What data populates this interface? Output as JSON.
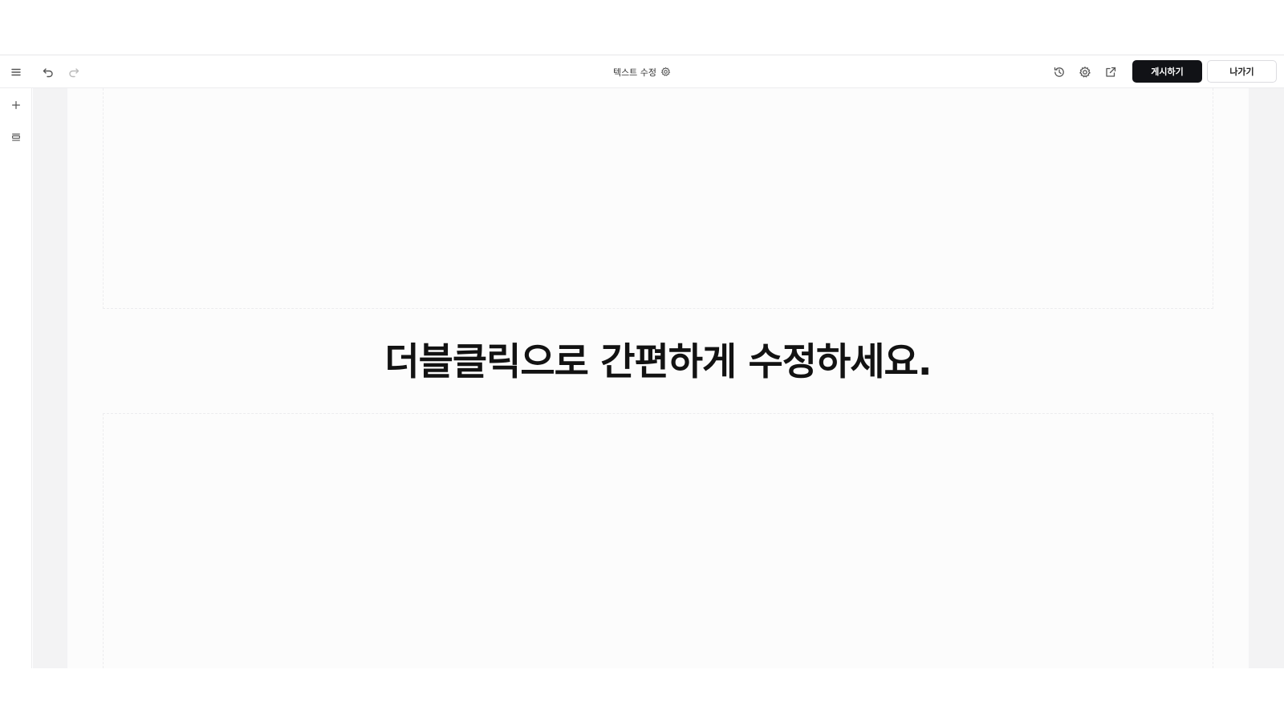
{
  "toolbar": {
    "menu_icon": "hamburger-menu-icon",
    "undo_icon": "undo-icon",
    "redo_icon": "redo-icon",
    "title": "텍스트 수정",
    "title_icon": "gear-icon",
    "history_icon": "history-icon",
    "settings_icon": "gear-icon",
    "open_external_icon": "external-link-icon",
    "publish_label": "게시하기",
    "exit_label": "나가기"
  },
  "left_rail": {
    "add_icon": "plus-icon",
    "layers_icon": "layers-icon"
  },
  "canvas": {
    "headline": "더블클릭으로 간편하게 수정하세요."
  },
  "colors": {
    "publish_bg": "#111216",
    "canvas_bg": "#f3f3f4",
    "page_bg": "#fcfcfc"
  }
}
